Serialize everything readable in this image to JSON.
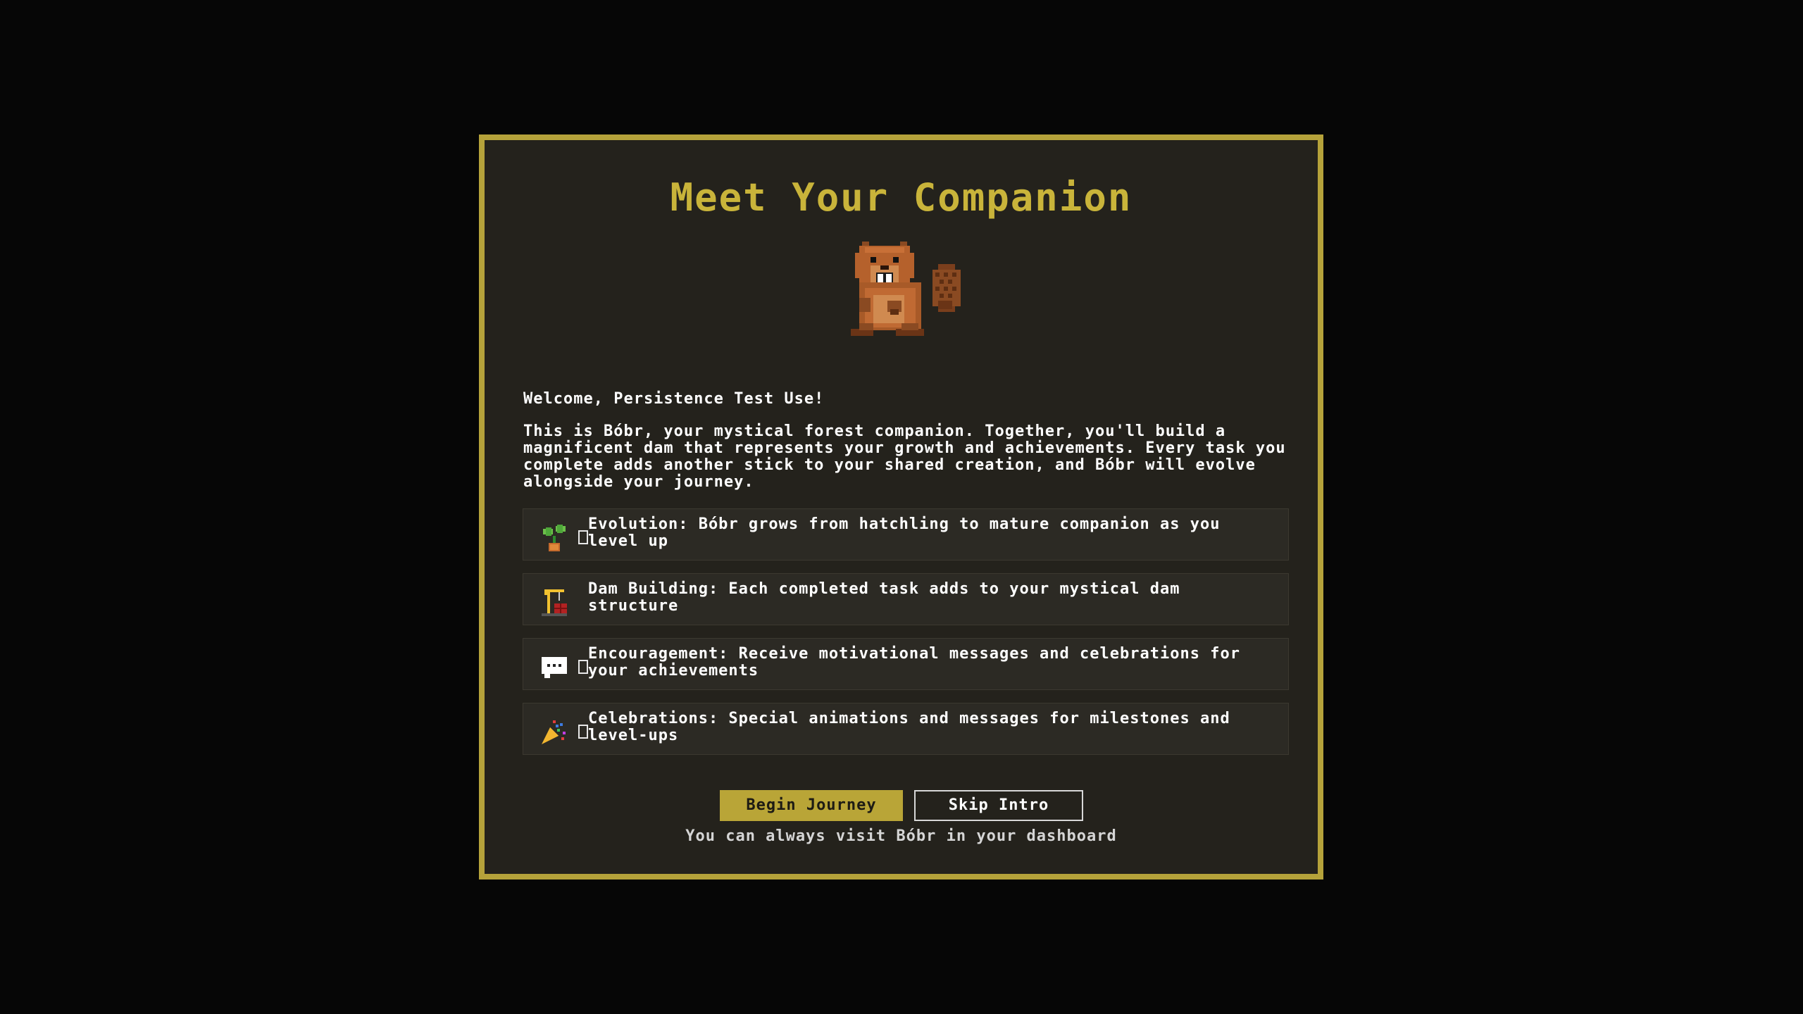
{
  "modal": {
    "title": "Meet Your Companion",
    "welcome": "Welcome, Persistence Test Use!",
    "intro": "This is Bóbr, your mystical forest companion. Together, you'll build a magnificent dam that represents your growth and achievements. Every task you complete adds another stick to your shared creation, and Bóbr will evolve alongside your journey.",
    "features": [
      {
        "icon": "seedling-icon",
        "text": "Evolution: Bóbr grows from hatchling to mature companion as you level up"
      },
      {
        "icon": "construction-icon",
        "text": "Dam Building: Each completed task adds to your mystical dam structure"
      },
      {
        "icon": "speech-bubble-icon",
        "text": "Encouragement: Receive motivational messages and celebrations for your achievements"
      },
      {
        "icon": "party-popper-icon",
        "text": "Celebrations: Special animations and messages for milestones and level-ups"
      }
    ],
    "begin_label": "Begin Journey",
    "skip_label": "Skip Intro",
    "footnote": "You can always visit Bóbr in your dashboard"
  },
  "colors": {
    "accent": "#b9a537",
    "title": "#c9b43a",
    "panel": "#24221c",
    "background": "#060606"
  }
}
